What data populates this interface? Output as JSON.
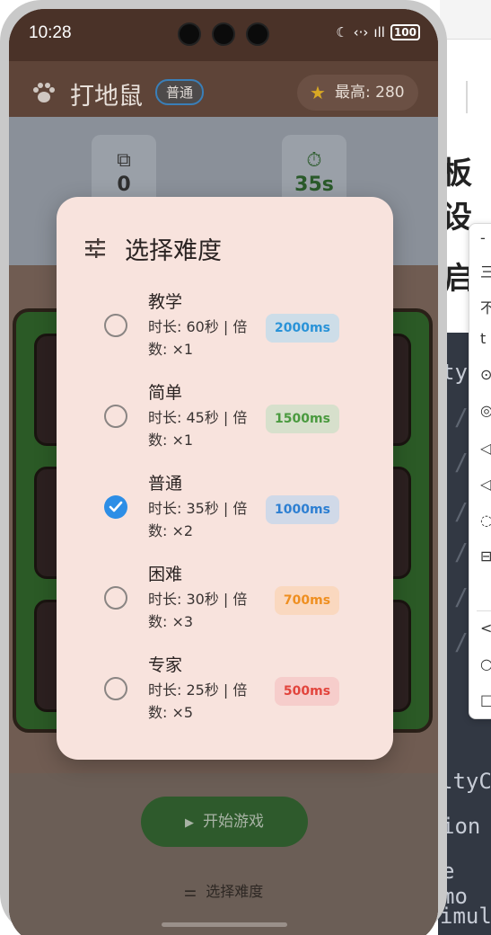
{
  "status": {
    "time": "10:28",
    "battery": "100"
  },
  "app": {
    "title": "打地鼠",
    "level_badge": "普通",
    "best_label": "最高: 280"
  },
  "stats": {
    "score_value": "0",
    "time_value": "35s"
  },
  "bottom": {
    "start_label": "开始游戏",
    "select_label": "选择难度"
  },
  "dialog": {
    "title": "选择难度",
    "options": [
      {
        "name": "教学",
        "desc": "时长: 60秒 | 倍数: ×1",
        "interval": "2000ms",
        "badge_bg": "#cddde8",
        "badge_fg": "#2a93d8",
        "checked": false
      },
      {
        "name": "简单",
        "desc": "时长: 45秒 | 倍数: ×1",
        "interval": "1500ms",
        "badge_bg": "#d7e0cc",
        "badge_fg": "#4a9a3f",
        "checked": false
      },
      {
        "name": "普通",
        "desc": "时长: 35秒 | 倍数: ×2",
        "interval": "1000ms",
        "badge_bg": "#d0d9e8",
        "badge_fg": "#2d7fd2",
        "checked": true
      },
      {
        "name": "困难",
        "desc": "时长: 30秒 | 倍数: ×3",
        "interval": "700ms",
        "badge_bg": "#fad8bf",
        "badge_fg": "#ef8f20",
        "checked": false
      },
      {
        "name": "专家",
        "desc": "时长: 25秒 | 倍数: ×5",
        "interval": "500ms",
        "badge_bg": "#f6cdcb",
        "badge_fg": "#e2443c",
        "checked": false
      }
    ]
  },
  "background": {
    "heading_1": "板设",
    "heading_2": "启",
    "code_lines": [
      "ty",
      "ltyC",
      "ion",
      "e mo",
      "imul"
    ],
    "menu_items": [
      "-",
      "三",
      "不",
      "t",
      "⊙",
      "◎",
      "◁",
      "◁",
      "◌",
      "⊟",
      "<",
      "○",
      "□"
    ]
  },
  "colors": {
    "accent": "#2d8ee6",
    "dialog_bg": "#f8e3dd"
  }
}
